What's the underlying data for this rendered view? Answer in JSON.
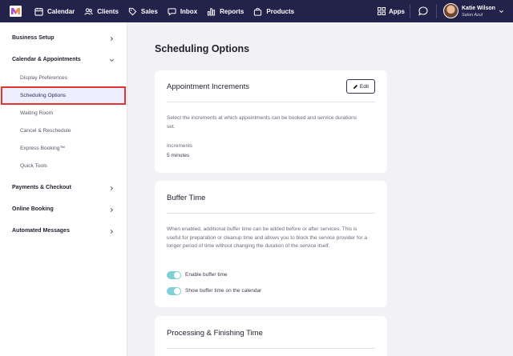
{
  "topbar": {
    "nav": [
      {
        "label": "Calendar",
        "icon": "calendar-icon"
      },
      {
        "label": "Clients",
        "icon": "users-icon"
      },
      {
        "label": "Sales",
        "icon": "tag-icon"
      },
      {
        "label": "Inbox",
        "icon": "chat-bubble-icon"
      },
      {
        "label": "Reports",
        "icon": "bar-chart-icon"
      },
      {
        "label": "Products",
        "icon": "shopping-bag-icon"
      }
    ],
    "apps_label": "Apps",
    "user_name": "Katie Wilson",
    "user_business": "Salon Azul"
  },
  "sidebar": {
    "sections": [
      {
        "label": "Business Setup"
      },
      {
        "label": "Calendar & Appointments"
      },
      {
        "label": "Payments & Checkout"
      },
      {
        "label": "Online Booking"
      },
      {
        "label": "Automated Messages"
      }
    ],
    "calendar_items": [
      {
        "label": "Display Preferences"
      },
      {
        "label": "Scheduling Options"
      },
      {
        "label": "Waiting Room"
      },
      {
        "label": "Cancel & Reschedule"
      },
      {
        "label": "Express Booking™"
      },
      {
        "label": "Quick Tools"
      }
    ]
  },
  "main": {
    "page_title": "Scheduling Options",
    "appointment_increments": {
      "title": "Appointment Increments",
      "edit_label": "Edit",
      "description": "Select the increments at which appointments can be booked and service durations set.",
      "field_label": "Increments",
      "field_value": "5 minutes"
    },
    "buffer_time": {
      "title": "Buffer Time",
      "description": "When enabled, additional buffer time can be added before or after services. This is useful for preparation or cleanup time and allows you to block the service provider for a longer period of time without changing the duration of the service itself.",
      "toggles": [
        {
          "label": "Enable buffer time",
          "on": true
        },
        {
          "label": "Show buffer time on the calendar",
          "on": true
        }
      ]
    },
    "processing": {
      "title": "Processing & Finishing Time"
    }
  },
  "colors": {
    "topbar": "#22224a",
    "toggle_on": "#7fd1d9",
    "selected_highlight": "#e3342f"
  }
}
